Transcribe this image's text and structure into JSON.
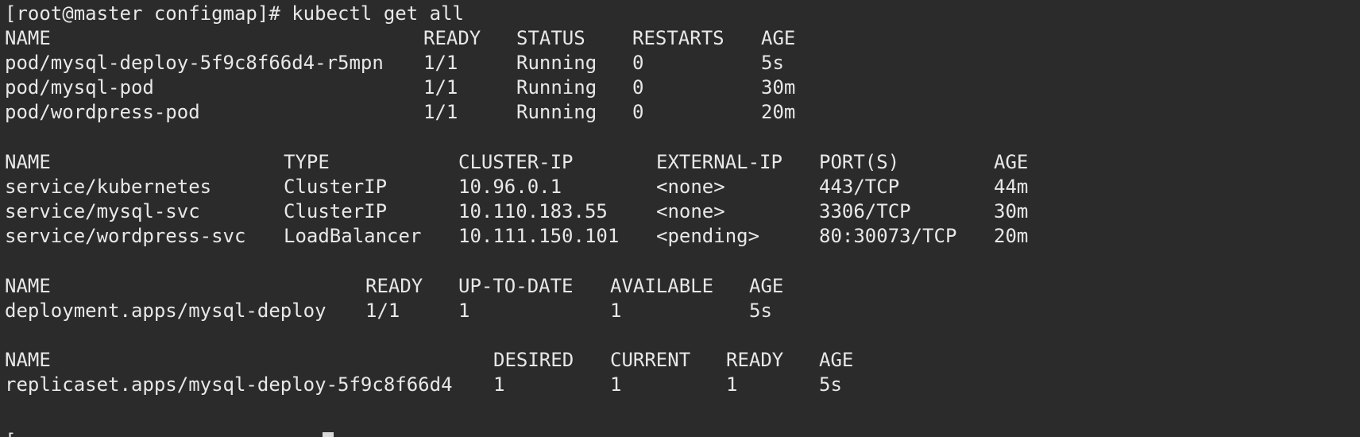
{
  "terminal": {
    "command_line": "[root@master configmap]# kubectl get all",
    "pods": {
      "headers": [
        "NAME",
        "READY",
        "STATUS",
        "RESTARTS",
        "AGE"
      ],
      "rows": [
        [
          "pod/mysql-deploy-5f9c8f66d4-r5mpn",
          "1/1",
          "Running",
          "0",
          "5s"
        ],
        [
          "pod/mysql-pod",
          "1/1",
          "Running",
          "0",
          "30m"
        ],
        [
          "pod/wordpress-pod",
          "1/1",
          "Running",
          "0",
          "20m"
        ]
      ]
    },
    "services": {
      "headers": [
        "NAME",
        "TYPE",
        "CLUSTER-IP",
        "EXTERNAL-IP",
        "PORT(S)",
        "AGE"
      ],
      "rows": [
        [
          "service/kubernetes",
          "ClusterIP",
          "10.96.0.1",
          "<none>",
          "443/TCP",
          "44m"
        ],
        [
          "service/mysql-svc",
          "ClusterIP",
          "10.110.183.55",
          "<none>",
          "3306/TCP",
          "30m"
        ],
        [
          "service/wordpress-svc",
          "LoadBalancer",
          "10.111.150.101",
          "<pending>",
          "80:30073/TCP",
          "20m"
        ]
      ]
    },
    "deployments": {
      "headers": [
        "NAME",
        "READY",
        "UP-TO-DATE",
        "AVAILABLE",
        "AGE"
      ],
      "rows": [
        [
          "deployment.apps/mysql-deploy",
          "1/1",
          "1",
          "1",
          "5s"
        ]
      ]
    },
    "replicasets": {
      "headers": [
        "NAME",
        "DESIRED",
        "CURRENT",
        "READY",
        "AGE"
      ],
      "rows": [
        [
          "replicaset.apps/mysql-deploy-5f9c8f66d4",
          "1",
          "1",
          "1",
          "5s"
        ]
      ]
    },
    "next_prompt": "["
  },
  "colors": {
    "background": "#2b2b2b",
    "text": "#e8e8e8",
    "cursor": "#d8d8d8"
  }
}
